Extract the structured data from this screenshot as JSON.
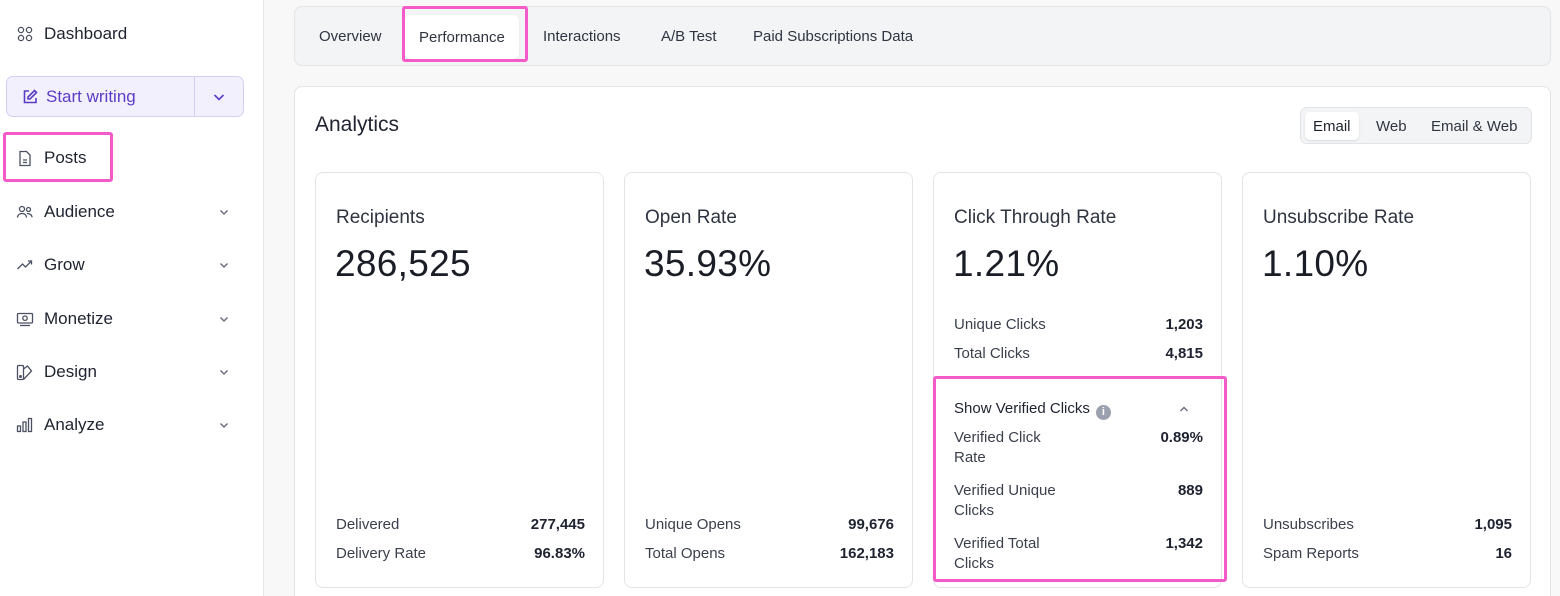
{
  "sidebar": {
    "dashboard": "Dashboard",
    "start_writing": "Start writing",
    "items": [
      {
        "label": "Posts",
        "icon": "file-icon"
      },
      {
        "label": "Audience",
        "icon": "users-icon"
      },
      {
        "label": "Grow",
        "icon": "trend-up-icon"
      },
      {
        "label": "Monetize",
        "icon": "money-icon"
      },
      {
        "label": "Design",
        "icon": "palette-icon"
      },
      {
        "label": "Analyze",
        "icon": "bar-chart-icon"
      }
    ]
  },
  "tabs": [
    {
      "label": "Overview"
    },
    {
      "label": "Performance",
      "active": true
    },
    {
      "label": "Interactions"
    },
    {
      "label": "A/B Test"
    },
    {
      "label": "Paid Subscriptions Data"
    }
  ],
  "analytics": {
    "title": "Analytics",
    "segments": [
      {
        "label": "Email",
        "active": true
      },
      {
        "label": "Web"
      },
      {
        "label": "Email & Web"
      }
    ],
    "cards": {
      "recipients": {
        "title": "Recipients",
        "value": "286,525",
        "rows": [
          {
            "label": "Delivered",
            "value": "277,445"
          },
          {
            "label": "Delivery Rate",
            "value": "96.83%"
          }
        ]
      },
      "open_rate": {
        "title": "Open Rate",
        "value": "35.93%",
        "rows": [
          {
            "label": "Unique Opens",
            "value": "99,676"
          },
          {
            "label": "Total Opens",
            "value": "162,183"
          }
        ]
      },
      "ctr": {
        "title": "Click Through Rate",
        "value": "1.21%",
        "rows": [
          {
            "label": "Unique Clicks",
            "value": "1,203"
          },
          {
            "label": "Total Clicks",
            "value": "4,815"
          }
        ],
        "verified_toggle": "Show Verified Clicks",
        "verified_rows": [
          {
            "label_line1": "Verified Click",
            "label_line2": "Rate",
            "value": "0.89%"
          },
          {
            "label_line1": "Verified Unique",
            "label_line2": "Clicks",
            "value": "889"
          },
          {
            "label_line1": "Verified Total",
            "label_line2": "Clicks",
            "value": "1,342"
          }
        ]
      },
      "unsubscribe": {
        "title": "Unsubscribe Rate",
        "value": "1.10%",
        "rows": [
          {
            "label": "Unsubscribes",
            "value": "1,095"
          },
          {
            "label": "Spam Reports",
            "value": "16"
          }
        ]
      }
    }
  },
  "colors": {
    "highlight": "#f45ac8",
    "accent": "#5b3cc4"
  }
}
